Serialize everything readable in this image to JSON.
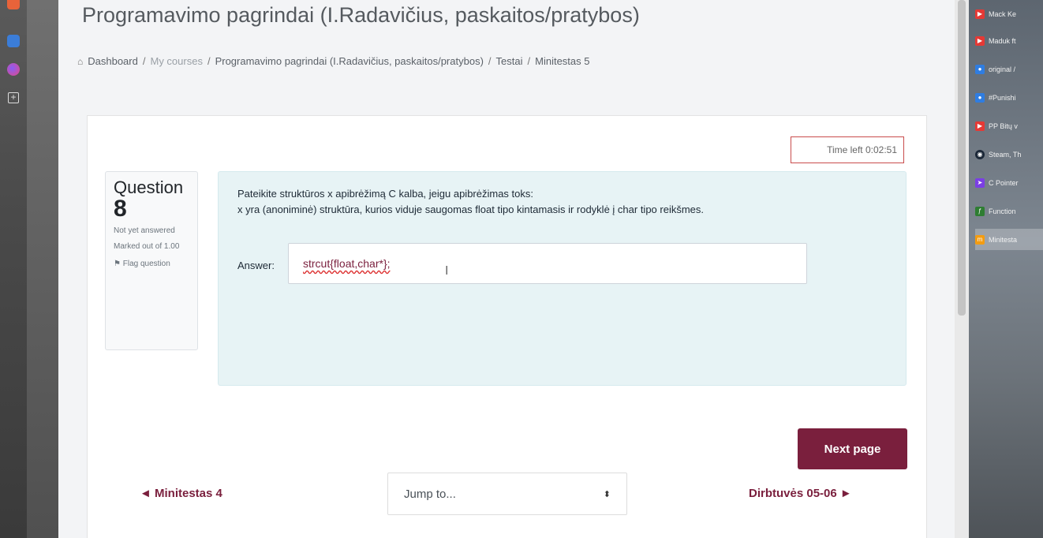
{
  "page": {
    "title": "Programavimo pagrindai (I.Radavičius, paskaitos/pratybos)"
  },
  "breadcrumb": {
    "items": [
      "Dashboard",
      "My courses",
      "Programavimo pagrindai (I.Radavičius, paskaitos/pratybos)",
      "Testai",
      "Minitestas 5"
    ],
    "separator": "/"
  },
  "timer": {
    "text": "Time left 0:02:51"
  },
  "question_info": {
    "label": "Question",
    "number": "8",
    "status": "Not yet answered",
    "marked": "Marked out of 1.00",
    "flag": "Flag question"
  },
  "question": {
    "line1": "Pateikite struktūros x apibrėžimą C kalba, jeigu apibrėžimas toks:",
    "line2": "x yra (anoniminė) struktūra, kurios viduje saugomas float tipo kintamasis ir rodyklė į char tipo reikšmes.",
    "answer_label": "Answer:",
    "answer_value": "strcut{float,char*};"
  },
  "navigation": {
    "next_button": "Next page",
    "prev_link": "◄ Minitestas 4",
    "jump_placeholder": "Jump to...",
    "next_link": "Dirbtuvės 05-06 ►"
  },
  "tabs": [
    {
      "label": "Mack Ke",
      "icon": "youtube-icon",
      "color": "#e53935"
    },
    {
      "label": "Maduk ft",
      "icon": "youtube-icon",
      "color": "#e53935"
    },
    {
      "label": "original /",
      "icon": "chat-icon",
      "color": "#2f7de1"
    },
    {
      "label": "#Punishi",
      "icon": "chat-icon",
      "color": "#2f7de1"
    },
    {
      "label": "PP Bitų v",
      "icon": "youtube-icon",
      "color": "#e53935"
    },
    {
      "label": "Steam, Th",
      "icon": "steam-icon",
      "color": "#1b2838"
    },
    {
      "label": "C Pointer",
      "icon": "pointer-icon",
      "color": "#7b3fe4"
    },
    {
      "label": "Function",
      "icon": "function-icon",
      "color": "#2e7d32"
    },
    {
      "label": "Minitesta",
      "icon": "moodle-icon",
      "color": "#f39c12"
    }
  ]
}
